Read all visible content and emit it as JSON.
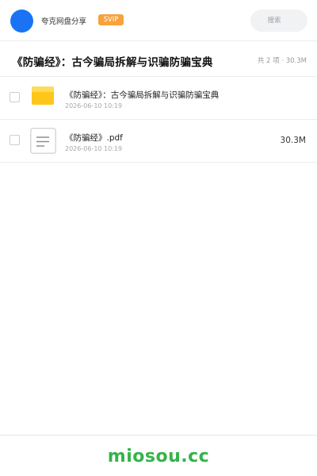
{
  "header": {
    "brand": "夸克网盘分享",
    "badge": "SVIP",
    "search_placeholder": "搜索",
    "accent_color": "#1a73f5",
    "badge_color": "#f7a23a"
  },
  "title_bar": {
    "title": "《防骗经》：古今骗局拆解与识骗防骗宝典",
    "meta": "共 2 项 · 30.3M"
  },
  "files": [
    {
      "icon": "folder-icon",
      "name": "《防骗经》：古今骗局拆解与识骗防骗宝典",
      "date": "2026-06-10 10:19",
      "size": ""
    },
    {
      "icon": "document-icon",
      "name": "《防骗经》.pdf",
      "date": "2026-06-10 10:19",
      "size": "30.3M"
    }
  ],
  "footer": {
    "watermark": "miosou.cc",
    "watermark_color": "#35b34a"
  }
}
